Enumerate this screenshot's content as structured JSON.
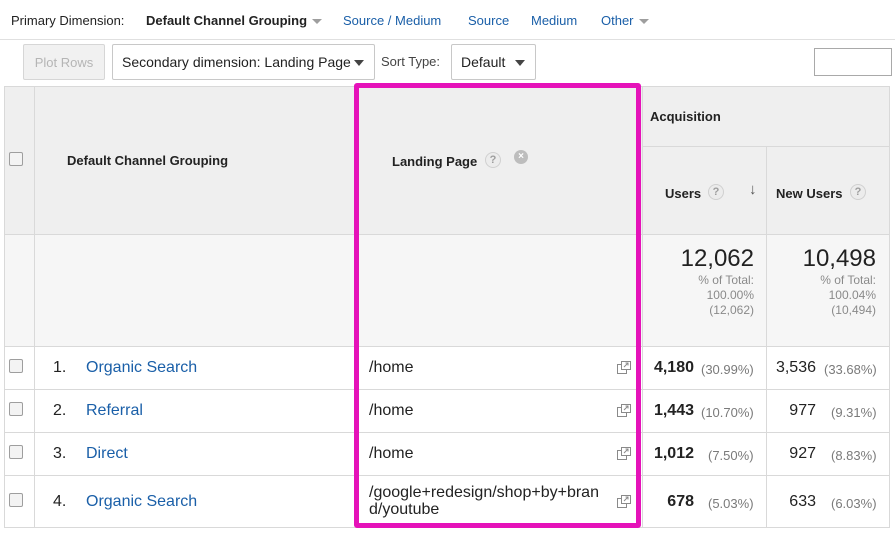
{
  "primary_dimension": {
    "label": "Primary Dimension:",
    "active": "Default Channel Grouping",
    "links": [
      "Source / Medium",
      "Source",
      "Medium",
      "Other"
    ]
  },
  "toolbar": {
    "plot_rows": "Plot Rows",
    "secondary_dimension": "Secondary dimension: Landing Page",
    "sort_type_label": "Sort Type:",
    "sort_type_value": "Default"
  },
  "table": {
    "headers": {
      "channel": "Default Channel Grouping",
      "landing_page": "Landing Page",
      "acquisition": "Acquisition",
      "users": "Users",
      "new_users": "New Users"
    },
    "totals": {
      "users": {
        "value": "12,062",
        "line1": "% of Total:",
        "line2": "100.00%",
        "line3": "(12,062)"
      },
      "new_users": {
        "value": "10,498",
        "line1": "% of Total:",
        "line2": "100.04%",
        "line3": "(10,494)"
      }
    },
    "rows": [
      {
        "num": "1.",
        "channel": "Organic Search",
        "landing_line1": "/home",
        "landing_line2": "",
        "users": "4,180",
        "users_pct": "(30.99%)",
        "new_users": "3,536",
        "new_users_pct": "(33.68%)"
      },
      {
        "num": "2.",
        "channel": "Referral",
        "landing_line1": "/home",
        "landing_line2": "",
        "users": "1,443",
        "users_pct": "(10.70%)",
        "new_users": "977",
        "new_users_pct": "(9.31%)"
      },
      {
        "num": "3.",
        "channel": "Direct",
        "landing_line1": "/home",
        "landing_line2": "",
        "users": "1,012",
        "users_pct": "(7.50%)",
        "new_users": "927",
        "new_users_pct": "(8.83%)"
      },
      {
        "num": "4.",
        "channel": "Organic Search",
        "landing_line1": "/google+redesign/shop+by+bran",
        "landing_line2": "d/youtube",
        "users": "678",
        "users_pct": "(5.03%)",
        "new_users": "633",
        "new_users_pct": "(6.03%)"
      }
    ]
  },
  "colors": {
    "highlight": "#e512b9",
    "link": "#1a5fa8"
  },
  "icons": {
    "help": "?",
    "close": "×",
    "sort_arrow": "↓"
  }
}
